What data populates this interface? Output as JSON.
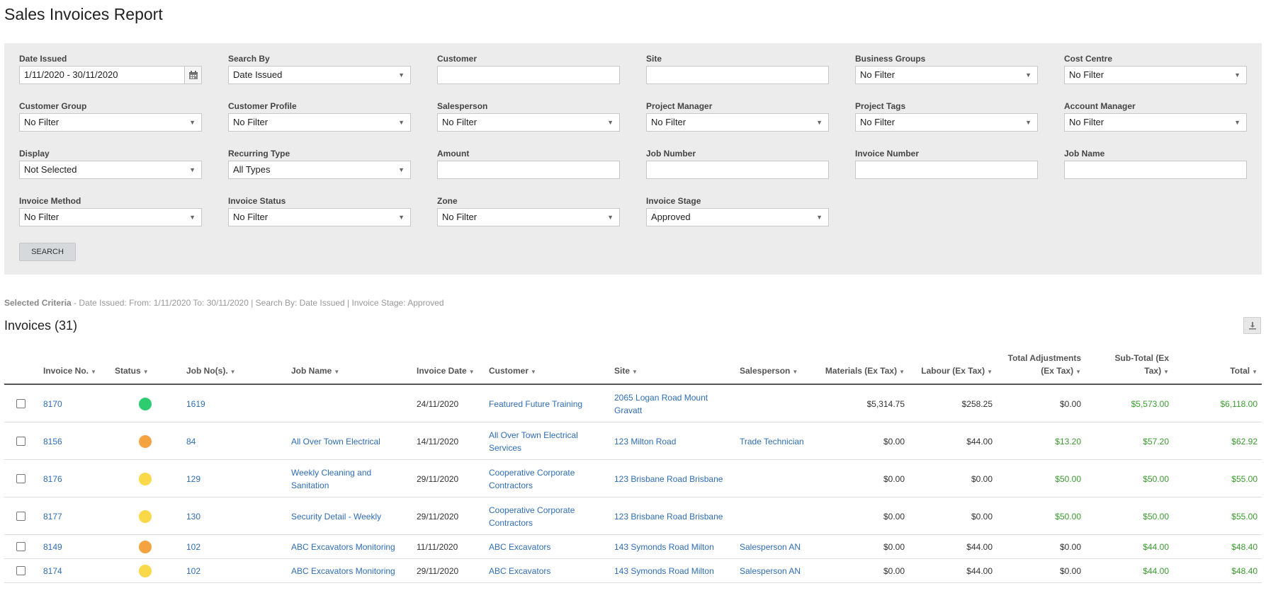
{
  "page": {
    "title": "Sales Invoices Report"
  },
  "filters": {
    "date_issued": {
      "label": "Date Issued",
      "value": "1/11/2020 - 30/11/2020"
    },
    "search_by": {
      "label": "Search By",
      "value": "Date Issued"
    },
    "customer": {
      "label": "Customer",
      "value": ""
    },
    "site": {
      "label": "Site",
      "value": ""
    },
    "business_groups": {
      "label": "Business Groups",
      "value": "No Filter"
    },
    "cost_centre": {
      "label": "Cost Centre",
      "value": "No Filter"
    },
    "customer_group": {
      "label": "Customer Group",
      "value": "No Filter"
    },
    "customer_profile": {
      "label": "Customer Profile",
      "value": "No Filter"
    },
    "salesperson": {
      "label": "Salesperson",
      "value": "No Filter"
    },
    "project_manager": {
      "label": "Project Manager",
      "value": "No Filter"
    },
    "project_tags": {
      "label": "Project Tags",
      "value": "No Filter"
    },
    "account_manager": {
      "label": "Account Manager",
      "value": "No Filter"
    },
    "display": {
      "label": "Display",
      "value": "Not Selected"
    },
    "recurring_type": {
      "label": "Recurring Type",
      "value": "All Types"
    },
    "amount": {
      "label": "Amount",
      "value": ""
    },
    "job_number": {
      "label": "Job Number",
      "value": ""
    },
    "invoice_number": {
      "label": "Invoice Number",
      "value": ""
    },
    "job_name": {
      "label": "Job Name",
      "value": ""
    },
    "invoice_method": {
      "label": "Invoice Method",
      "value": "No Filter"
    },
    "invoice_status": {
      "label": "Invoice Status",
      "value": "No Filter"
    },
    "zone": {
      "label": "Zone",
      "value": "No Filter"
    },
    "invoice_stage": {
      "label": "Invoice Stage",
      "value": "Approved"
    },
    "search_label": "SEARCH"
  },
  "criteria": {
    "prefix": "Selected Criteria",
    "text": " - Date Issued: From: 1/11/2020 To: 30/11/2020 | Search By: Date Issued | Invoice Stage: Approved"
  },
  "invoices": {
    "heading": "Invoices (31)",
    "columns": {
      "invoice_no": "Invoice No.",
      "status": "Status",
      "job_nos": "Job No(s).",
      "job_name": "Job Name",
      "invoice_date": "Invoice Date",
      "customer": "Customer",
      "site": "Site",
      "salesperson": "Salesperson",
      "materials": "Materials (Ex Tax)",
      "labour": "Labour (Ex Tax)",
      "total_adjustments_1": "Total Adjustments",
      "total_adjustments_2": "(Ex Tax)",
      "subtotal_1": "Sub-Total (Ex",
      "subtotal_2": "Tax)",
      "total": "Total"
    },
    "status_colors": {
      "green": "#2ecc71",
      "orange": "#f4a340",
      "yellow": "#f9d84a"
    },
    "rows": [
      {
        "invoice_no": "8170",
        "status": "green",
        "job_no": "1619",
        "job_name": "",
        "invoice_date": "24/11/2020",
        "customer": "Featured Future Training",
        "site": "2065 Logan Road Mount Gravatt",
        "salesperson": "",
        "materials": "$5,314.75",
        "labour": "$258.25",
        "adjustments": "$0.00",
        "subtotal": "$5,573.00",
        "total": "$6,118.00"
      },
      {
        "invoice_no": "8156",
        "status": "orange",
        "job_no": "84",
        "job_name": "All Over Town Electrical",
        "invoice_date": "14/11/2020",
        "customer": "All Over Town Electrical Services",
        "site": "123 Milton Road",
        "salesperson": "Trade Technician",
        "materials": "$0.00",
        "labour": "$44.00",
        "adjustments": "$13.20",
        "subtotal": "$57.20",
        "total": "$62.92"
      },
      {
        "invoice_no": "8176",
        "status": "yellow",
        "job_no": "129",
        "job_name": "Weekly Cleaning and Sanitation",
        "invoice_date": "29/11/2020",
        "customer": "Cooperative Corporate Contractors",
        "site": "123 Brisbane Road Brisbane",
        "salesperson": "",
        "materials": "$0.00",
        "labour": "$0.00",
        "adjustments": "$50.00",
        "subtotal": "$50.00",
        "total": "$55.00"
      },
      {
        "invoice_no": "8177",
        "status": "yellow",
        "job_no": "130",
        "job_name": "Security Detail - Weekly",
        "invoice_date": "29/11/2020",
        "customer": "Cooperative Corporate Contractors",
        "site": "123 Brisbane Road Brisbane",
        "salesperson": "",
        "materials": "$0.00",
        "labour": "$0.00",
        "adjustments": "$50.00",
        "subtotal": "$50.00",
        "total": "$55.00"
      },
      {
        "invoice_no": "8149",
        "status": "orange",
        "job_no": "102",
        "job_name": "ABC Excavators Monitoring",
        "invoice_date": "11/11/2020",
        "customer": "ABC Excavators",
        "site": "143 Symonds Road Milton",
        "salesperson": "Salesperson AN",
        "materials": "$0.00",
        "labour": "$44.00",
        "adjustments": "$0.00",
        "subtotal": "$44.00",
        "total": "$48.40"
      },
      {
        "invoice_no": "8174",
        "status": "yellow",
        "job_no": "102",
        "job_name": "ABC Excavators Monitoring",
        "invoice_date": "29/11/2020",
        "customer": "ABC Excavators",
        "site": "143 Symonds Road Milton",
        "salesperson": "Salesperson AN",
        "materials": "$0.00",
        "labour": "$44.00",
        "adjustments": "$0.00",
        "subtotal": "$44.00",
        "total": "$48.40"
      }
    ]
  }
}
